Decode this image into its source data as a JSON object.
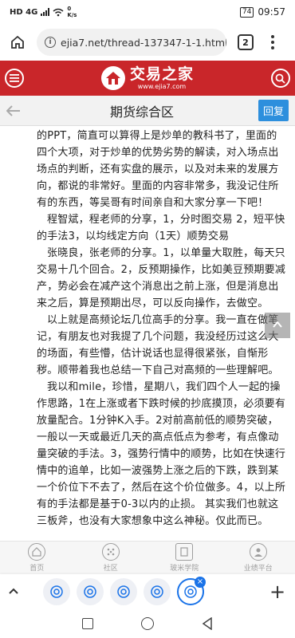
{
  "status": {
    "speed": "0\nK/s",
    "battery": "74",
    "time": "09:57",
    "network": "HD 4G"
  },
  "browser": {
    "url": "ejia7.net/thread-137347-1-1.html",
    "tab_count": "2"
  },
  "site": {
    "logo_title": "交易之家",
    "logo_sub": "www.ejia7.com"
  },
  "page": {
    "title": "期货综合区",
    "reply_label": "回复"
  },
  "article": {
    "paragraphs": [
      "的PPT，简直可以算得上是炒单的教科书了，里面的四个大项，对于炒单的优势劣势的解读，对入场点出场点的判断，还有实盘的展示，以及对未来的发展方向，都说的非常好。里面的内容非常多，我没记住所有的东西，等吴哥有时间亲自和大家分享一下吧！",
      "程智斌，程老师的分享，1，分时图交易 2，短平快的手法3，以均线定方向（1天）顺势交易",
      "张晓良，张老师的分享。1，以单量大取胜，每天只交易十几个回合。2，反预期操作，比如美豆预期要减产，势必会在减产这个消息出之前上涨，但是消息出来之后，算是预期出尽，可以反向操作，去做空。",
      "以上就是高频论坛几位高手的分享。我一直在做笔记，有朋友也对我提了几个问题，我没经历过这么大的场面，有些懵，估计说话也显得很紧张，自惭形秽。顺带着我也总结一下自己对高频的一些理解吧。",
      "我以和mile，珍惜，星期八，我们四个人一起的操作思路，1在上涨或者下跌时候的抄底摸顶，必须要有放量配合。1分钟K入手。2对前高前低的顺势突破，一般以一天或最近几天的高点低点为参考，有点像动量突破的手法。3，强势行情中的顺势，比如在快速行情中的追单，比如一波强势上涨之后的下跌，跌到某一个价位下不去了，然后在这个价位做多。4，以上所有的手法都是基于0-3以内的止损。 其实我们也就这三板斧，也没有大家想象中这么神秘。仅此而已。"
    ]
  },
  "site_nav": [
    {
      "label": "首页",
      "icon": "home-icon"
    },
    {
      "label": "社区",
      "icon": "grid-icon"
    },
    {
      "label": "玻米学院",
      "icon": "document-icon"
    },
    {
      "label": "业绩平台",
      "icon": "user-icon"
    }
  ],
  "colors": {
    "brand_red": "#c9262a",
    "reply_blue": "#2d8fdd",
    "tab_blue": "#1a73e8"
  }
}
